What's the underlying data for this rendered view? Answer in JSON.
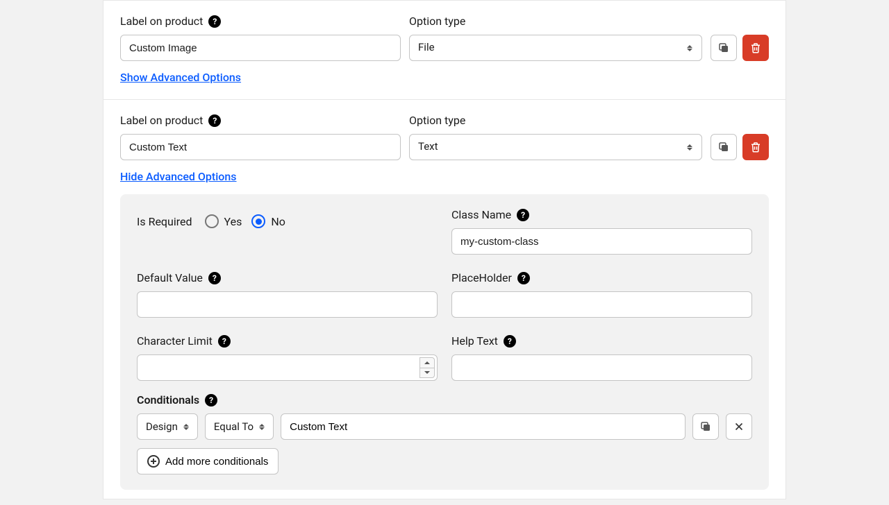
{
  "options": [
    {
      "label_text": "Label on product",
      "label_value": "Custom Image",
      "type_text": "Option type",
      "type_value": "File",
      "adv_link": "Show Advanced Options",
      "expanded": false
    },
    {
      "label_text": "Label on product",
      "label_value": "Custom Text",
      "type_text": "Option type",
      "type_value": "Text",
      "adv_link": "Hide Advanced Options",
      "expanded": true,
      "advanced": {
        "is_required_label": "Is Required",
        "yes": "Yes",
        "no": "No",
        "is_required_value": "No",
        "class_name_label": "Class Name",
        "class_name_value": "my-custom-class",
        "default_value_label": "Default Value",
        "default_value": "",
        "placeholder_label": "PlaceHolder",
        "placeholder_value": "",
        "char_limit_label": "Character Limit",
        "char_limit_value": "",
        "help_text_label": "Help Text",
        "help_text_value": "",
        "conditionals_label": "Conditionals",
        "cond_field": "Design",
        "cond_op": "Equal To",
        "cond_value": "Custom Text",
        "add_more": "Add more conditionals"
      }
    }
  ]
}
